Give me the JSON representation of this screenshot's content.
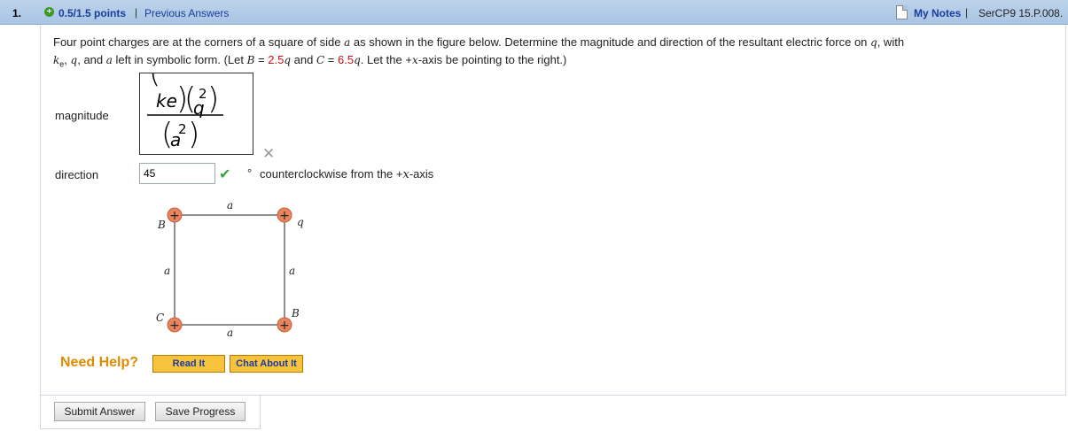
{
  "header": {
    "question_number": "1.",
    "points": "0.5/1.5 points",
    "separator": "|",
    "previous_answers": "Previous Answers",
    "my_notes": "My Notes",
    "code": "SerCP9 15.P.008."
  },
  "question": {
    "line1_a": "Four point charges are at the corners of a square of side ",
    "var_a": "a",
    "line1_b": " as shown in the figure below. Determine the magnitude and direction of the resultant electric force on ",
    "var_q": "q",
    "line1_c": ", with",
    "var_ke": "k",
    "ke_sub": "e",
    "comma1": ", ",
    "var_q2": "q",
    "and_a": ", and ",
    "var_a2": "a",
    "line2_b": " left in symbolic form. (Let ",
    "var_B": "B",
    "eq1": " = ",
    "B_value": "2.5",
    "var_q3": "q",
    "and2": " and ",
    "var_C": "C",
    "eq2": " = ",
    "C_value": "6.5",
    "var_q4": "q",
    "line2_c": ". Let the +",
    "var_x": "x",
    "line2_d": "-axis be pointing to the right.)"
  },
  "magnitude": {
    "label": "magnitude",
    "num_ke": "ke",
    "num_q": "q",
    "num_exp": "2",
    "den_a": "a",
    "den_exp": "2",
    "status_icon": "x-icon"
  },
  "direction": {
    "label": "direction",
    "value": "45",
    "status_icon": "checkmark-icon",
    "degree": "°",
    "unit_a": "counterclockwise from the +",
    "unit_x": "x",
    "unit_b": "-axis"
  },
  "figure": {
    "top_label": "a",
    "bottom_label": "a",
    "left_label": "a",
    "right_label": "a",
    "corner_top_left": "B",
    "corner_top_right": "q",
    "corner_bottom_left": "C",
    "corner_bottom_right": "B",
    "charge_symbol": "+",
    "charge_color": "#e8845e"
  },
  "help": {
    "label": "Need Help?",
    "read_it": "Read It",
    "chat": "Chat About It"
  },
  "actions": {
    "submit": "Submit Answer",
    "save": "Save Progress"
  },
  "colors": {
    "header_bg": "#a9c5e4",
    "link": "#1a3c9c",
    "accent_red": "#cc1111",
    "help_orange": "#e08a00",
    "check_green": "#3aa33a"
  }
}
